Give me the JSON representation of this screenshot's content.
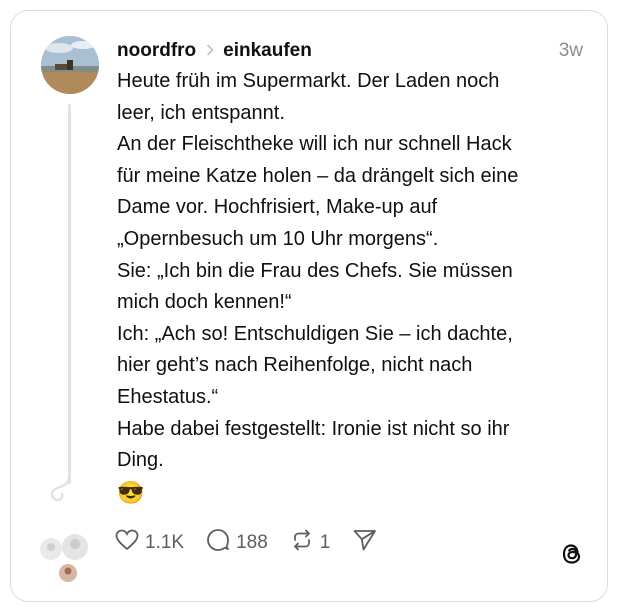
{
  "post": {
    "username": "noordfro",
    "community": "einkaufen",
    "time": "3w",
    "lines": [
      "Heute früh im Supermarkt. Der Laden noch",
      "leer, ich entspannt.",
      "An der Fleischtheke will ich nur schnell Hack",
      "für meine Katze holen – da drängelt sich eine",
      "Dame vor. Hochfrisiert, Make-up auf",
      "„Opernbesuch um 10 Uhr morgens“.",
      "Sie: „Ich bin die Frau des Chefs. Sie müssen",
      "mich doch kennen!“",
      "Ich: „Ach so! Entschuldigen Sie – ich dachte,",
      "hier geht’s nach Reihenfolge, nicht nach",
      "Ehestatus.“",
      "Habe dabei festgestellt: Ironie ist nicht so ihr",
      "Ding."
    ],
    "emoji": "😎"
  },
  "actions": {
    "likes": "1.1K",
    "replies": "188",
    "reposts": "1"
  },
  "icons": {
    "like": "heart-icon",
    "reply": "comment-icon",
    "repost": "repost-icon",
    "share": "send-icon",
    "logo": "threads-logo-icon"
  }
}
